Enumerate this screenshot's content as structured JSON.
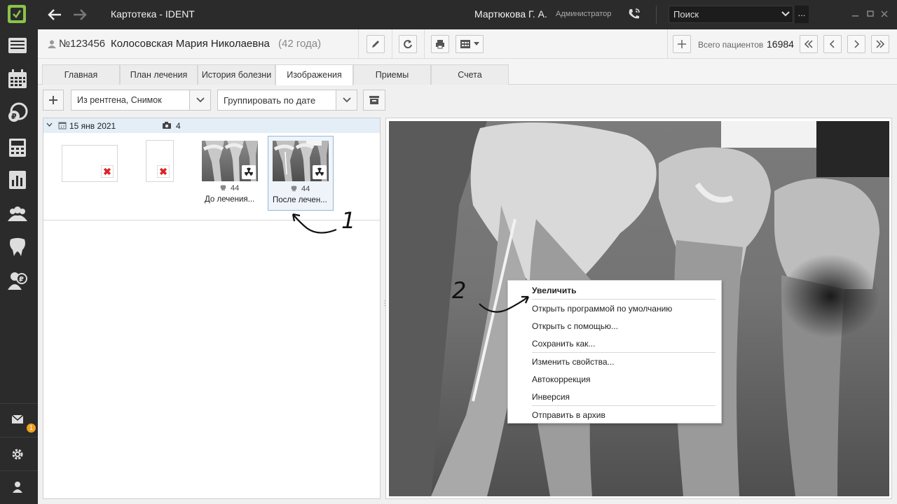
{
  "app": {
    "title": "Картотека - IDENT",
    "user": "Мартюкова Г. А.",
    "role": "Администратор",
    "search_placeholder": "Поиск",
    "search_more": "...",
    "notification_count": "1"
  },
  "patient": {
    "number": "№123456",
    "name": "Колосовская Мария Николаевна",
    "age": "(42 года)",
    "total_label": "Всего пациентов",
    "total_value": "16984"
  },
  "tabs": [
    {
      "label": "Главная"
    },
    {
      "label": "План лечения"
    },
    {
      "label": "История болезни"
    },
    {
      "label": "Изображения"
    },
    {
      "label": "Приемы"
    },
    {
      "label": "Счета"
    }
  ],
  "toolbar": {
    "source_filter": "Из рентгена, Снимок",
    "group_by": "Группировать по дате"
  },
  "gallery": {
    "group_date": "15 янв 2021",
    "group_count": "4",
    "thumbs": [
      {
        "tooth": "44",
        "caption": "До лечения..."
      },
      {
        "tooth": "44",
        "caption": "После лечен..."
      }
    ]
  },
  "context_menu": {
    "items": [
      "Увеличить",
      "Открыть программой по умолчанию",
      "Открыть с помощью...",
      "Сохранить как...",
      "Изменить свойства...",
      "Автокоррекция",
      "Инверсия",
      "Отправить в архив"
    ]
  },
  "annotations": [
    "1",
    "2"
  ],
  "colors": {
    "sidebar": "#2b2b2b",
    "accent_green": "#8bc34a",
    "badge": "#f0a020",
    "selection": "#e3eef7"
  }
}
